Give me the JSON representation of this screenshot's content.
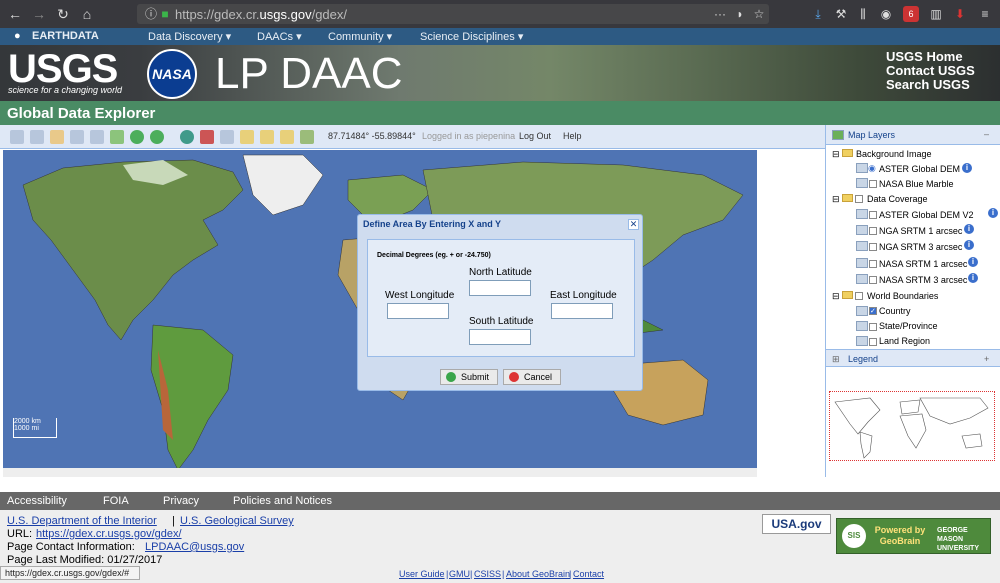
{
  "browser": {
    "url_prefix": "https://gdex.cr.",
    "url_domain": "usgs.gov",
    "url_path": "/gdex/",
    "notification_count": "6"
  },
  "earthdata": {
    "brand": "EARTHDATA",
    "nav": [
      "Data Discovery",
      "DAACs",
      "Community",
      "Science Disciplines"
    ]
  },
  "banner": {
    "usgs": "USGS",
    "usgs_tagline": "science for a changing world",
    "nasa": "NASA",
    "title": "LP DAAC",
    "links": [
      "USGS Home",
      "Contact USGS",
      "Search USGS"
    ]
  },
  "app": {
    "title": "Global Data Explorer"
  },
  "toolbar": {
    "coords": "87.71484° -55.89844°",
    "logged_in": "Logged in as piepenina",
    "logout": "Log Out",
    "help": "Help"
  },
  "map": {
    "scale_km": "2000 km",
    "scale_mi": "1000 mi"
  },
  "dialog": {
    "title": "Define Area By Entering X and Y",
    "hint": "Decimal Degrees (eg. + or -24.750)",
    "north": "North Latitude",
    "west": "West Longitude",
    "east": "East Longitude",
    "south": "South Latitude",
    "north_value": "",
    "west_value": "",
    "east_value": "",
    "south_value": "",
    "submit": "Submit",
    "cancel": "Cancel"
  },
  "layers": {
    "title": "Map Layers",
    "background_group": "Background Image",
    "background_items": [
      "ASTER Global DEM",
      "NASA Blue Marble"
    ],
    "coverage_group": "Data Coverage",
    "coverage_items": [
      "ASTER Global DEM V2",
      "NGA SRTM 1 arcsec",
      "NGA SRTM 3 arcsec",
      "NASA SRTM 1 arcsec",
      "NASA SRTM 3 arcsec"
    ],
    "boundaries_group": "World Boundaries",
    "boundary_items": [
      "Country",
      "State/Province",
      "Land Region"
    ],
    "legend": "Legend"
  },
  "footer": {
    "nav": [
      "Accessibility",
      "FOIA",
      "Privacy",
      "Policies and Notices"
    ],
    "doi": "U.S. Department of the Interior",
    "sep": "|",
    "usgs": "U.S. Geological Survey",
    "url_label": "URL:",
    "url": "https://gdex.cr.usgs.gov/gdex/",
    "contact_label": "Page Contact Information:",
    "contact_email": "LPDAAC@usgs.gov",
    "modified": "Page Last Modified: 01/27/2017",
    "usagov": "USA.gov",
    "powered_by": "Powered by GeoBrain",
    "mason": "GEORGE MASON UNIVERSITY",
    "bottom_links": [
      "User Guide",
      "GMU",
      "CSISS",
      "About GeoBrain",
      "Contact"
    ],
    "status_url": "https://gdex.cr.usgs.gov/gdex/#"
  }
}
